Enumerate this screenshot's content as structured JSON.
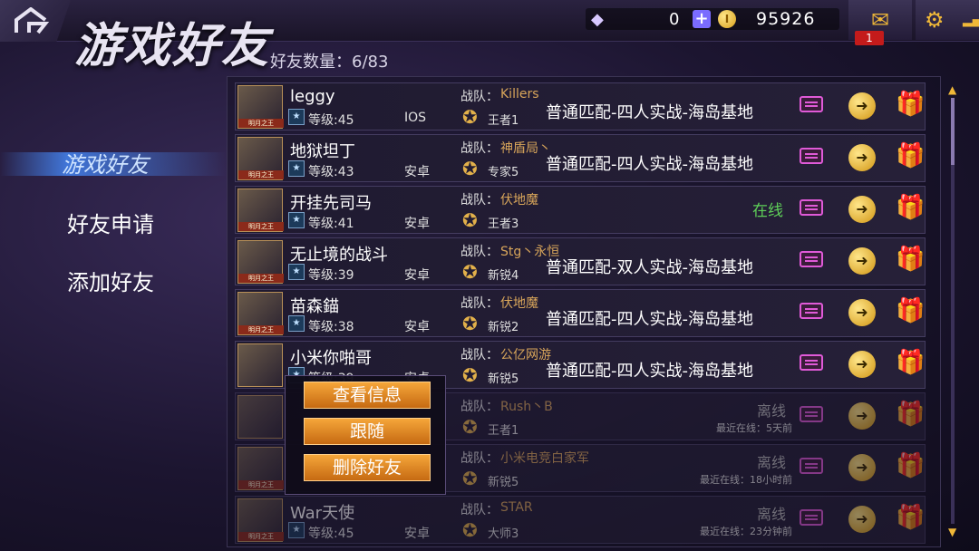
{
  "header": {
    "title": "游戏好友",
    "friend_count": "好友数量：6/83",
    "diamonds": "0",
    "gold": "95926",
    "mail_badge": "1"
  },
  "nav": {
    "items": [
      {
        "label": "游戏好友",
        "active": true
      },
      {
        "label": "好友申请",
        "active": false
      },
      {
        "label": "添加好友",
        "active": false
      }
    ]
  },
  "friends": [
    {
      "name": "leggy",
      "level": "等级:45",
      "platform": "IOS",
      "team_label": "战队：",
      "team": "Killers",
      "rank": "王者1",
      "status": "普通匹配-四人实战-海岛基地",
      "online": "",
      "offline": "",
      "last_seen": "",
      "avatar_tag": "明月之王"
    },
    {
      "name": "地狱坦丁",
      "level": "等级:43",
      "platform": "安卓",
      "team_label": "战队：",
      "team": "神盾局丶",
      "rank": "专家5",
      "status": "普通匹配-四人实战-海岛基地",
      "online": "",
      "offline": "",
      "last_seen": "",
      "avatar_tag": "明月之王"
    },
    {
      "name": "开挂先司马",
      "level": "等级:41",
      "platform": "安卓",
      "team_label": "战队：",
      "team": "伏地魔",
      "rank": "王者3",
      "status": "",
      "online": "在线",
      "offline": "",
      "last_seen": "",
      "avatar_tag": "明月之王"
    },
    {
      "name": "无止境的战斗",
      "level": "等级:39",
      "platform": "安卓",
      "team_label": "战队：",
      "team": "Stg丶永恒",
      "rank": "新锐4",
      "status": "普通匹配-双人实战-海岛基地",
      "online": "",
      "offline": "",
      "last_seen": "",
      "avatar_tag": "明月之王"
    },
    {
      "name": "苗森錨",
      "level": "等级:38",
      "platform": "安卓",
      "team_label": "战队：",
      "team": "伏地魔",
      "rank": "新锐2",
      "status": "普通匹配-四人实战-海岛基地",
      "online": "",
      "offline": "",
      "last_seen": "",
      "avatar_tag": "明月之王"
    },
    {
      "name": "小米你啪哥",
      "level": "等级:39",
      "platform": "安卓",
      "team_label": "战队：",
      "team": "公亿网游",
      "rank": "新锐5",
      "status": "普通匹配-四人实战-海岛基地",
      "online": "",
      "offline": "",
      "last_seen": "",
      "avatar_tag": ""
    },
    {
      "name": "",
      "level": "",
      "platform": "",
      "team_label": "战队：",
      "team": "Rush丶B",
      "rank": "王者1",
      "status": "",
      "online": "",
      "offline": "离线",
      "last_seen": "最近在线：5天前",
      "avatar_tag": ""
    },
    {
      "name": "",
      "level": "",
      "platform": "",
      "team_label": "战队：",
      "team": "小米电竞白家军",
      "rank": "新锐5",
      "status": "",
      "online": "",
      "offline": "离线",
      "last_seen": "最近在线：18小时前",
      "avatar_tag": "明月之王"
    },
    {
      "name": "War天使",
      "level": "等级:45",
      "platform": "安卓",
      "team_label": "战队：",
      "team": "STAR",
      "rank": "大师3",
      "status": "",
      "online": "",
      "offline": "离线",
      "last_seen": "最近在线：23分钟前",
      "avatar_tag": "明月之王"
    }
  ],
  "popup": {
    "view_info": "查看信息",
    "follow": "跟随",
    "delete": "删除好友"
  },
  "icons": [
    "home-icon",
    "diamond-icon",
    "plus-icon",
    "coin-icon",
    "mail-icon",
    "gear-icon",
    "signal-icon",
    "chat-icon",
    "invite-icon",
    "gift-icon"
  ]
}
